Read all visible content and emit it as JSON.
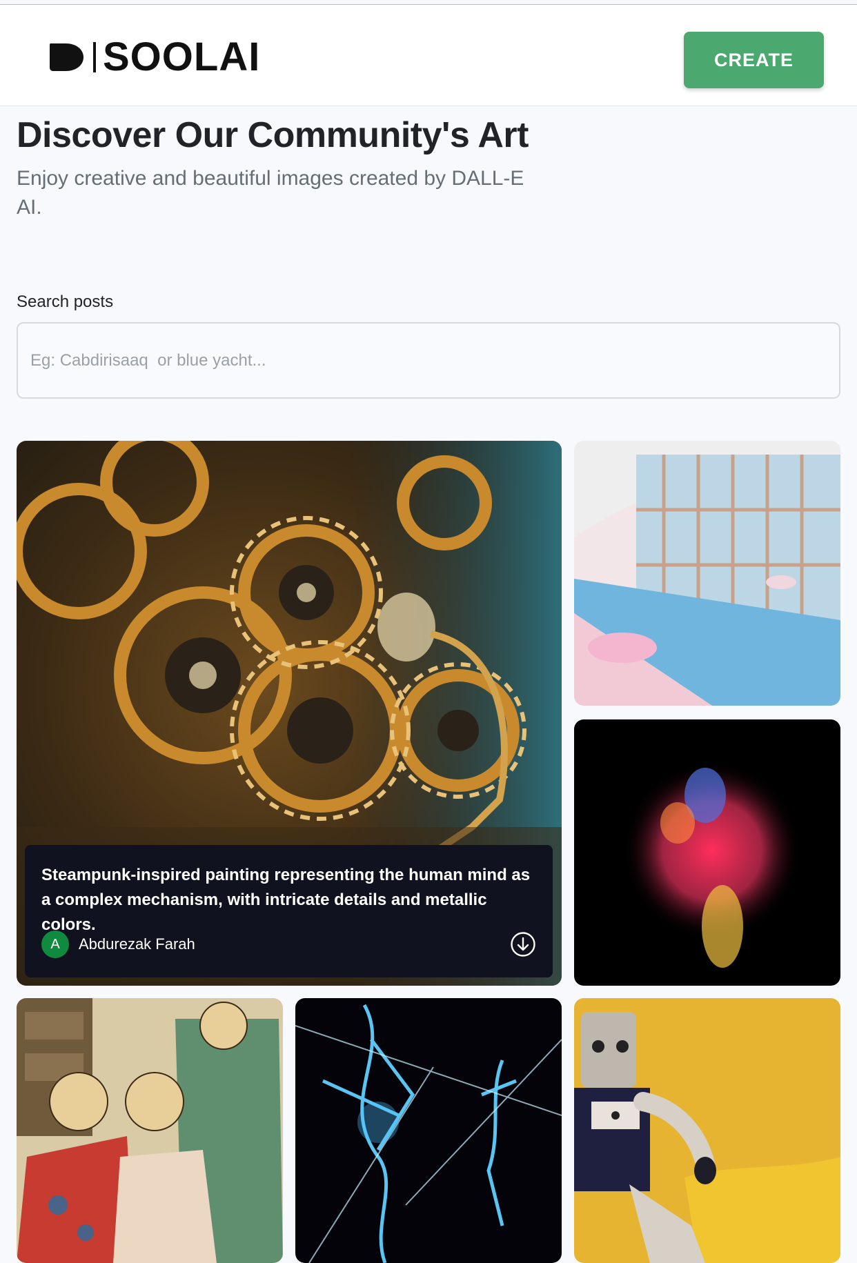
{
  "header": {
    "logo_text": "SOOLAI",
    "create_label": "CREATE"
  },
  "hero": {
    "title": "Discover Our Community's Art",
    "subtitle": "Enjoy creative and beautiful images created by DALL-E AI."
  },
  "search": {
    "label": "Search posts",
    "placeholder": "Eg: Cabdirisaaq  or blue yacht..."
  },
  "gallery": {
    "featured": {
      "prompt": "Steampunk-inspired painting representing the human mind as a complex mechanism, with intricate details and metallic colors.",
      "author_initial": "A",
      "author": "Abdurezak Farah"
    },
    "items": [
      {
        "image": "steampunk-gears-head-painting"
      },
      {
        "image": "indoor-pool-pink-chairs"
      },
      {
        "image": "colorful-powder-explosion"
      },
      {
        "image": "bears-in-kimonos-woodblock"
      },
      {
        "image": "neon-blue-abstract-figures"
      },
      {
        "image": "plush-robot-yellow-wall"
      }
    ]
  },
  "colors": {
    "brand_green": "#4ba86f",
    "caption_bg": "#10131f",
    "avatar_green": "#0f8a3e"
  }
}
